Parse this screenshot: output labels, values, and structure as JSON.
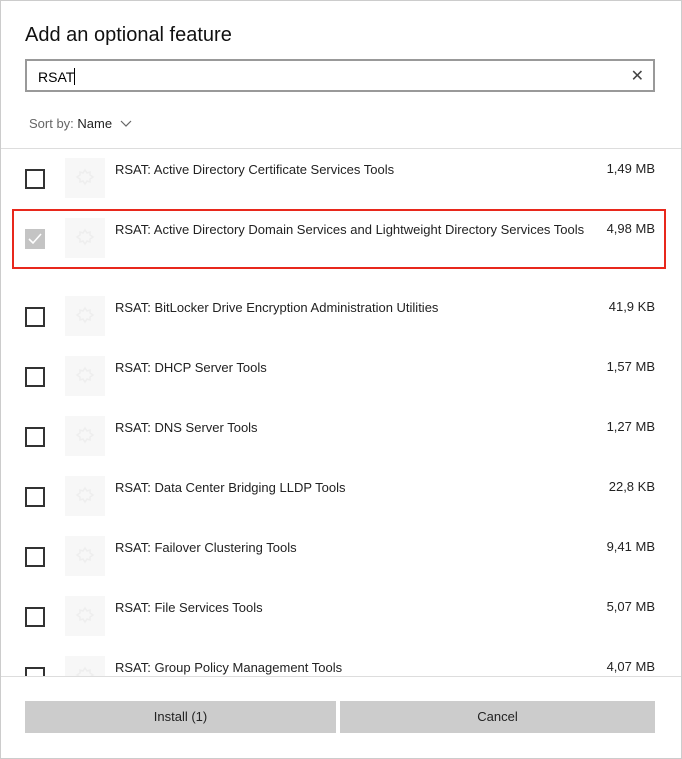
{
  "dialog": {
    "title": "Add an optional feature"
  },
  "search": {
    "value": "RSAT",
    "clear_icon": "close-icon"
  },
  "sort": {
    "label": "Sort by:",
    "value": "Name"
  },
  "features": [
    {
      "name": "RSAT: Active Directory Certificate Services Tools",
      "size": "1,49 MB",
      "checked": false
    },
    {
      "name": "RSAT: Active Directory Domain Services and Lightweight Directory Services Tools",
      "size": "4,98 MB",
      "checked": true,
      "highlighted": true
    },
    {
      "name": "RSAT: BitLocker Drive Encryption Administration Utilities",
      "size": "41,9 KB",
      "checked": false
    },
    {
      "name": "RSAT: DHCP Server Tools",
      "size": "1,57 MB",
      "checked": false
    },
    {
      "name": "RSAT: DNS Server Tools",
      "size": "1,27 MB",
      "checked": false
    },
    {
      "name": "RSAT: Data Center Bridging LLDP Tools",
      "size": "22,8 KB",
      "checked": false
    },
    {
      "name": "RSAT: Failover Clustering Tools",
      "size": "9,41 MB",
      "checked": false
    },
    {
      "name": "RSAT: File Services Tools",
      "size": "5,07 MB",
      "checked": false
    },
    {
      "name": "RSAT: Group Policy Management Tools",
      "size": "4,07 MB",
      "checked": false
    }
  ],
  "footer": {
    "install_label": "Install (1)",
    "cancel_label": "Cancel"
  },
  "colors": {
    "highlight": "#e8281c",
    "button": "#cccccc"
  }
}
